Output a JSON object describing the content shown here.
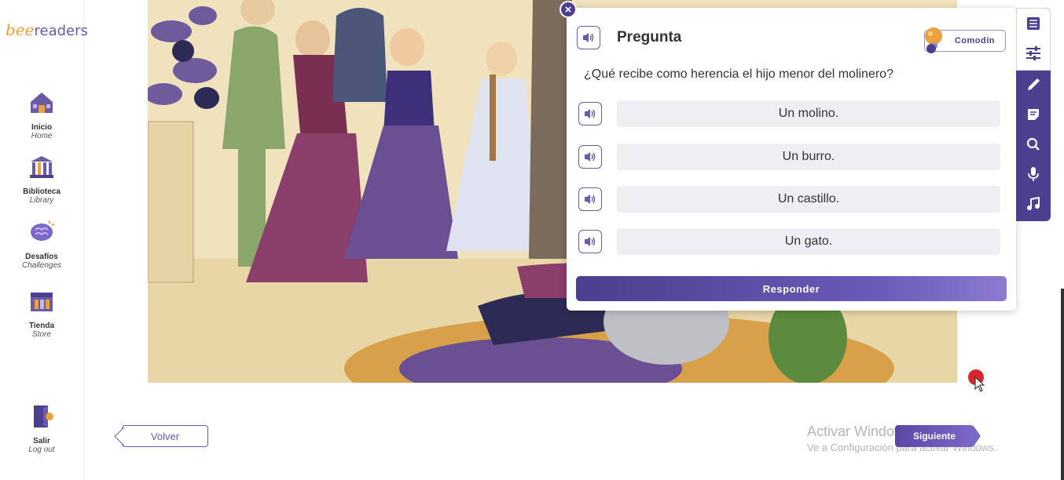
{
  "brand": {
    "logo_prefix": "bee",
    "logo_suffix": "readers"
  },
  "sidebar": {
    "items": [
      {
        "label": "Inicio",
        "sub": "Home",
        "icon": "house-icon"
      },
      {
        "label": "Biblioteca",
        "sub": "Library",
        "icon": "library-icon"
      },
      {
        "label": "Desafíos",
        "sub": "Challenges",
        "icon": "brain-icon"
      },
      {
        "label": "Tienda",
        "sub": "Store",
        "icon": "store-icon"
      },
      {
        "label": "Salir",
        "sub": "Log out",
        "icon": "logout-door-icon"
      }
    ]
  },
  "question_panel": {
    "title": "Pregunta",
    "wildcard_label": "Comodín",
    "question": "¿Qué recibe como herencia el hijo menor del molinero?",
    "answers": [
      "Un molino.",
      "Un burro.",
      "Un castillo.",
      "Un gato."
    ],
    "submit_label": "Responder"
  },
  "toolbar": {
    "icons": [
      "list-icon",
      "sliders-icon",
      "pencil-icon",
      "note-icon",
      "search-icon",
      "microphone-icon",
      "music-note-icon"
    ]
  },
  "navigation": {
    "back_label": "Volver",
    "next_label": "Siguiente"
  },
  "watermark": {
    "title": "Activar Windows",
    "subtitle": "Ve a Configuración para activar Windows."
  },
  "colors": {
    "accent": "#4b3f8f",
    "brand_gold": "#e9a13a",
    "answer_bg": "#eeeef3"
  }
}
